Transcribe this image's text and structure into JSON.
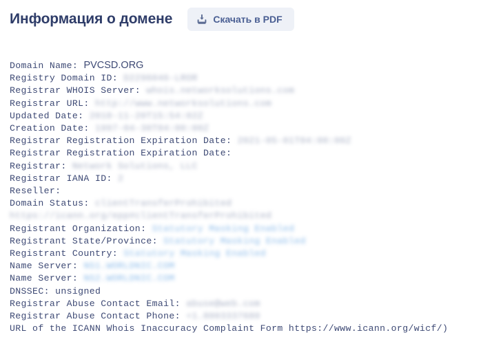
{
  "header": {
    "title": "Информация о домене",
    "pdf_button_label": "Скачать в PDF",
    "pdf_icon": "download-icon"
  },
  "theme": {
    "title_color": "#2f3d69",
    "text_color": "#3e4a75",
    "button_bg": "#eef1f7",
    "button_text": "#4a5f93",
    "masked_gray": "#9aa3bb",
    "masked_blue": "#7fb4e8",
    "page_bg": "#ffffff"
  },
  "whois": {
    "lines": [
      {
        "label": "Domain Name:",
        "value": "PVCSD.ORG",
        "style": "plain-sans"
      },
      {
        "label": "Registry Domain ID:",
        "value": "D2296046-LROR",
        "style": "masked"
      },
      {
        "label": "Registrar WHOIS Server:",
        "value": "whois.networksolutions.com",
        "style": "masked"
      },
      {
        "label": "Registrar URL:",
        "value": "http://www.networksolutions.com",
        "style": "masked"
      },
      {
        "label": "Updated Date:",
        "value": "2018-11-20T15:54:02Z",
        "style": "masked"
      },
      {
        "label": "Creation Date:",
        "value": "1997-04-30T04:00:00Z",
        "style": "masked"
      },
      {
        "label": "Registrar Registration Expiration Date:",
        "value": "2021-05-01T04:00:00Z",
        "style": "masked"
      },
      {
        "label": "Registrar Registration Expiration Date:",
        "value": "",
        "style": "plain"
      },
      {
        "label": "Registrar:",
        "value": "Network Solutions, LLC",
        "style": "masked"
      },
      {
        "label": "Registrar IANA ID:",
        "value": "2",
        "style": "masked"
      },
      {
        "label": "Reseller:",
        "value": "",
        "style": "plain"
      },
      {
        "label": "Domain Status:",
        "value": "clientTransferProhibited https://icann.org/epp#clientTransferProhibited",
        "style": "masked"
      },
      {
        "label": "Registrant Organization:",
        "value": "Statutory Masking Enabled",
        "style": "masked-blue"
      },
      {
        "label": "Registrant State/Province:",
        "value": "Statutory Masking Enabled",
        "style": "masked-blue"
      },
      {
        "label": "Registrant Country:",
        "value": "Statutory Masking Enabled",
        "style": "masked-blue"
      },
      {
        "label": "Name Server:",
        "value": "NS1.WORLDNIC.COM",
        "style": "masked-blue"
      },
      {
        "label": "Name Server:",
        "value": "NS2.WORLDNIC.COM",
        "style": "masked-blue"
      },
      {
        "label": "DNSSEC:",
        "value": "unsigned",
        "style": "plain"
      },
      {
        "label": "Registrar Abuse Contact Email:",
        "value": "abuse@web.com",
        "style": "masked"
      },
      {
        "label": "Registrar Abuse Contact Phone:",
        "value": "+1.8003337680",
        "style": "masked"
      },
      {
        "label": "URL of the ICANN Whois Inaccuracy Complaint Form https://www.icann.org/wicf/)",
        "value": "",
        "style": "plain"
      }
    ]
  }
}
